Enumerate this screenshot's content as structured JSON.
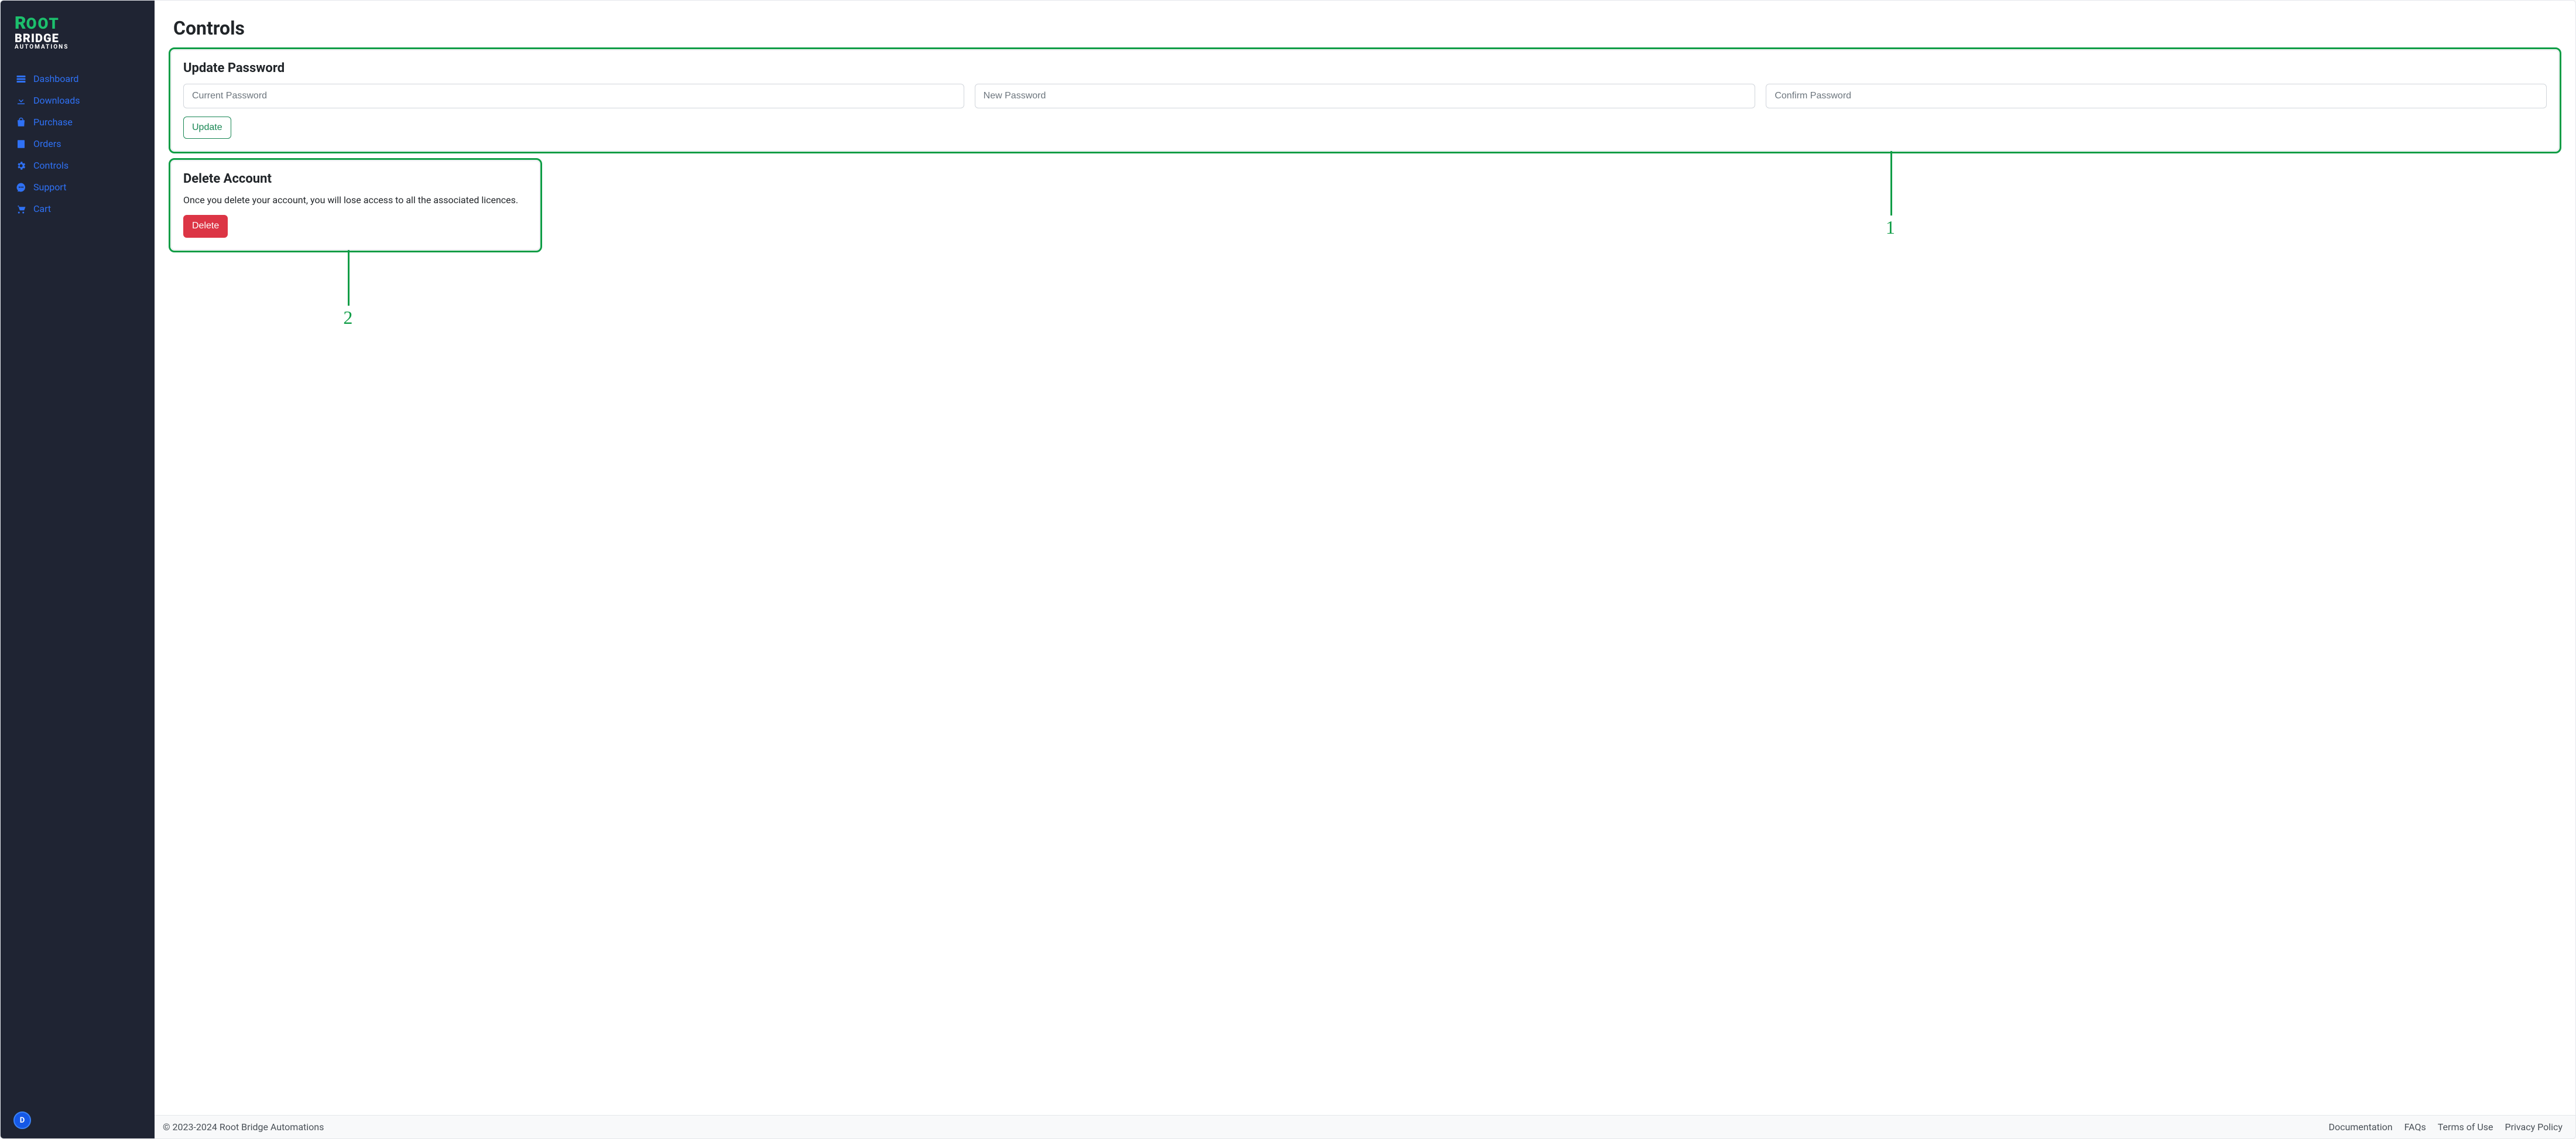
{
  "brand": {
    "mark": "R",
    "line1_rest": "OOT",
    "line2": "BRIDGE",
    "line3": "AUTOMATIONS"
  },
  "sidebar": {
    "items": [
      {
        "label": "Dashboard",
        "icon": "dashboard-icon"
      },
      {
        "label": "Downloads",
        "icon": "download-icon"
      },
      {
        "label": "Purchase",
        "icon": "bag-icon"
      },
      {
        "label": "Orders",
        "icon": "list-icon"
      },
      {
        "label": "Controls",
        "icon": "gear-icon"
      },
      {
        "label": "Support",
        "icon": "support-icon"
      },
      {
        "label": "Cart",
        "icon": "cart-icon"
      }
    ],
    "avatar_initial": "D"
  },
  "page": {
    "title": "Controls"
  },
  "update_password": {
    "heading": "Update Password",
    "current_placeholder": "Current Password",
    "new_placeholder": "New Password",
    "confirm_placeholder": "Confirm Password",
    "button": "Update"
  },
  "delete_account": {
    "heading": "Delete Account",
    "description": "Once you delete your account, you will lose access to all the associated licences.",
    "button": "Delete"
  },
  "annotations": {
    "one": "1",
    "two": "2"
  },
  "footer": {
    "copyright": "© 2023-2024 Root Bridge Automations",
    "links": [
      "Documentation",
      "FAQs",
      "Terms of Use",
      "Privacy Policy"
    ]
  },
  "colors": {
    "accent_blue": "#2f71f5",
    "brand_green": "#1cc06d",
    "highlight_green": "#0f9d46",
    "danger": "#dc3545",
    "success": "#198754",
    "sidebar_bg": "#1f2433"
  }
}
